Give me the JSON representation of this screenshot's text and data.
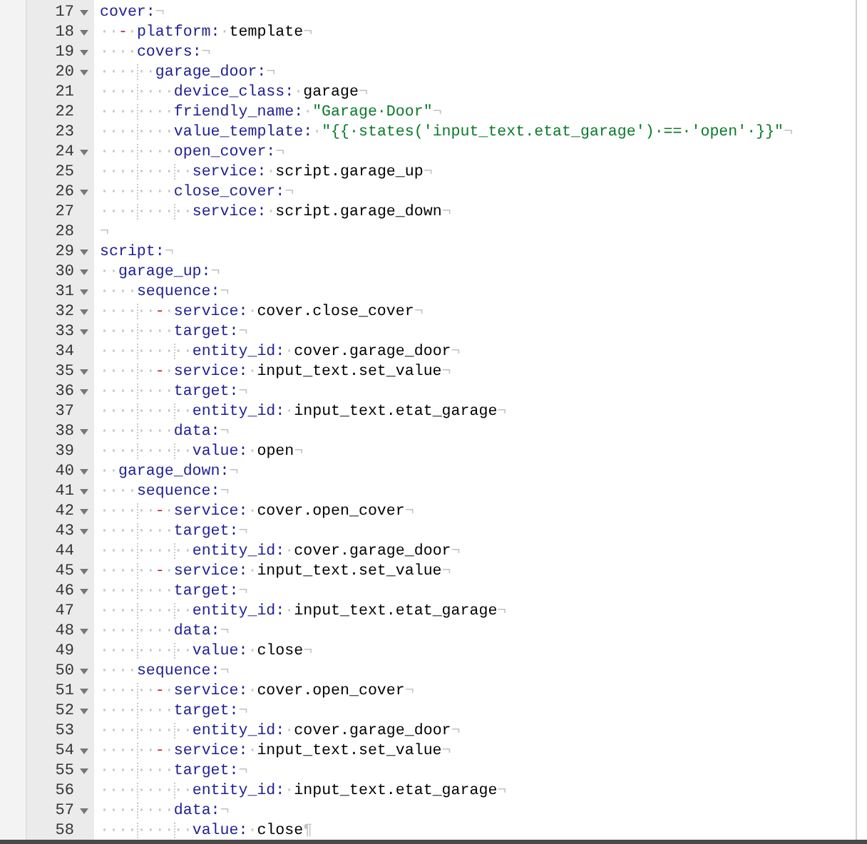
{
  "lines": [
    {
      "number": "17",
      "foldable": true,
      "parts": [
        {
          "kind": "key",
          "text": "cover:"
        }
      ],
      "eol": "¬"
    },
    {
      "number": "18",
      "foldable": true,
      "indent": "··",
      "parts": [
        {
          "kind": "dash",
          "text": "-"
        },
        {
          "kind": "ws",
          "text": "·"
        },
        {
          "kind": "key",
          "text": "platform:"
        },
        {
          "kind": "ws",
          "text": "·"
        },
        {
          "kind": "val",
          "text": "template"
        }
      ],
      "eol": "¬"
    },
    {
      "number": "19",
      "foldable": true,
      "indent": "····",
      "parts": [
        {
          "kind": "key",
          "text": "covers:"
        }
      ],
      "eol": "¬"
    },
    {
      "number": "20",
      "foldable": true,
      "indent": "······",
      "parts": [
        {
          "kind": "key",
          "text": "garage_door:"
        }
      ],
      "eol": "¬"
    },
    {
      "number": "21",
      "foldable": false,
      "indent": "········",
      "parts": [
        {
          "kind": "key",
          "text": "device_class:"
        },
        {
          "kind": "ws",
          "text": "·"
        },
        {
          "kind": "val",
          "text": "garage"
        }
      ],
      "eol": "¬"
    },
    {
      "number": "22",
      "foldable": false,
      "indent": "········",
      "parts": [
        {
          "kind": "key",
          "text": "friendly_name:"
        },
        {
          "kind": "ws",
          "text": "·"
        },
        {
          "kind": "str",
          "text": "\"Garage·Door\""
        }
      ],
      "eol": "¬"
    },
    {
      "number": "23",
      "foldable": false,
      "indent": "········",
      "parts": [
        {
          "kind": "key",
          "text": "value_template:"
        },
        {
          "kind": "ws",
          "text": "·"
        },
        {
          "kind": "str",
          "text": "\"{{·states('input_text.etat_garage')·==·'open'·}}\""
        }
      ],
      "eol": "¬"
    },
    {
      "number": "24",
      "foldable": true,
      "indent": "········",
      "parts": [
        {
          "kind": "key",
          "text": "open_cover:"
        }
      ],
      "eol": "¬"
    },
    {
      "number": "25",
      "foldable": false,
      "indent": "··········",
      "parts": [
        {
          "kind": "key",
          "text": "service:"
        },
        {
          "kind": "ws",
          "text": "·"
        },
        {
          "kind": "val",
          "text": "script.garage_up"
        }
      ],
      "eol": "¬"
    },
    {
      "number": "26",
      "foldable": true,
      "indent": "········",
      "parts": [
        {
          "kind": "key",
          "text": "close_cover:"
        }
      ],
      "eol": "¬"
    },
    {
      "number": "27",
      "foldable": false,
      "indent": "··········",
      "parts": [
        {
          "kind": "key",
          "text": "service:"
        },
        {
          "kind": "ws",
          "text": "·"
        },
        {
          "kind": "val",
          "text": "script.garage_down"
        }
      ],
      "eol": "¬"
    },
    {
      "number": "28",
      "foldable": false,
      "eol": "¬"
    },
    {
      "number": "29",
      "foldable": true,
      "parts": [
        {
          "kind": "key",
          "text": "script:"
        }
      ],
      "eol": "¬"
    },
    {
      "number": "30",
      "foldable": true,
      "indent": "··",
      "parts": [
        {
          "kind": "key",
          "text": "garage_up:"
        }
      ],
      "eol": "¬"
    },
    {
      "number": "31",
      "foldable": true,
      "indent": "····",
      "parts": [
        {
          "kind": "key",
          "text": "sequence:"
        }
      ],
      "eol": "¬"
    },
    {
      "number": "32",
      "foldable": true,
      "indent": "······",
      "parts": [
        {
          "kind": "dash",
          "text": "-"
        },
        {
          "kind": "ws",
          "text": "·"
        },
        {
          "kind": "key",
          "text": "service:"
        },
        {
          "kind": "ws",
          "text": "·"
        },
        {
          "kind": "val",
          "text": "cover.close_cover"
        }
      ],
      "eol": "¬"
    },
    {
      "number": "33",
      "foldable": true,
      "indent": "········",
      "parts": [
        {
          "kind": "key",
          "text": "target:"
        }
      ],
      "eol": "¬"
    },
    {
      "number": "34",
      "foldable": false,
      "indent": "··········",
      "parts": [
        {
          "kind": "key",
          "text": "entity_id:"
        },
        {
          "kind": "ws",
          "text": "·"
        },
        {
          "kind": "val",
          "text": "cover.garage_door"
        }
      ],
      "eol": "¬"
    },
    {
      "number": "35",
      "foldable": true,
      "indent": "······",
      "parts": [
        {
          "kind": "dash",
          "text": "-"
        },
        {
          "kind": "ws",
          "text": "·"
        },
        {
          "kind": "key",
          "text": "service:"
        },
        {
          "kind": "ws",
          "text": "·"
        },
        {
          "kind": "val",
          "text": "input_text.set_value"
        }
      ],
      "eol": "¬"
    },
    {
      "number": "36",
      "foldable": true,
      "indent": "········",
      "parts": [
        {
          "kind": "key",
          "text": "target:"
        }
      ],
      "eol": "¬"
    },
    {
      "number": "37",
      "foldable": false,
      "indent": "··········",
      "parts": [
        {
          "kind": "key",
          "text": "entity_id:"
        },
        {
          "kind": "ws",
          "text": "·"
        },
        {
          "kind": "val",
          "text": "input_text.etat_garage"
        }
      ],
      "eol": "¬"
    },
    {
      "number": "38",
      "foldable": true,
      "indent": "········",
      "parts": [
        {
          "kind": "key",
          "text": "data:"
        }
      ],
      "eol": "¬"
    },
    {
      "number": "39",
      "foldable": false,
      "indent": "··········",
      "parts": [
        {
          "kind": "key",
          "text": "value:"
        },
        {
          "kind": "ws",
          "text": "·"
        },
        {
          "kind": "val",
          "text": "open"
        }
      ],
      "eol": "¬"
    },
    {
      "number": "40",
      "foldable": true,
      "indent": "··",
      "parts": [
        {
          "kind": "key",
          "text": "garage_down:"
        }
      ],
      "eol": "¬"
    },
    {
      "number": "41",
      "foldable": true,
      "indent": "····",
      "parts": [
        {
          "kind": "key",
          "text": "sequence:"
        }
      ],
      "eol": "¬"
    },
    {
      "number": "42",
      "foldable": true,
      "indent": "······",
      "parts": [
        {
          "kind": "dash",
          "text": "-"
        },
        {
          "kind": "ws",
          "text": "·"
        },
        {
          "kind": "key",
          "text": "service:"
        },
        {
          "kind": "ws",
          "text": "·"
        },
        {
          "kind": "val",
          "text": "cover.open_cover"
        }
      ],
      "eol": "¬"
    },
    {
      "number": "43",
      "foldable": true,
      "indent": "········",
      "parts": [
        {
          "kind": "key",
          "text": "target:"
        }
      ],
      "eol": "¬"
    },
    {
      "number": "44",
      "foldable": false,
      "indent": "··········",
      "parts": [
        {
          "kind": "key",
          "text": "entity_id:"
        },
        {
          "kind": "ws",
          "text": "·"
        },
        {
          "kind": "val",
          "text": "cover.garage_door"
        }
      ],
      "eol": "¬"
    },
    {
      "number": "45",
      "foldable": true,
      "indent": "······",
      "parts": [
        {
          "kind": "dash",
          "text": "-"
        },
        {
          "kind": "ws",
          "text": "·"
        },
        {
          "kind": "key",
          "text": "service:"
        },
        {
          "kind": "ws",
          "text": "·"
        },
        {
          "kind": "val",
          "text": "input_text.set_value"
        }
      ],
      "eol": "¬"
    },
    {
      "number": "46",
      "foldable": true,
      "indent": "········",
      "parts": [
        {
          "kind": "key",
          "text": "target:"
        }
      ],
      "eol": "¬"
    },
    {
      "number": "47",
      "foldable": false,
      "indent": "··········",
      "parts": [
        {
          "kind": "key",
          "text": "entity_id:"
        },
        {
          "kind": "ws",
          "text": "·"
        },
        {
          "kind": "val",
          "text": "input_text.etat_garage"
        }
      ],
      "eol": "¬"
    },
    {
      "number": "48",
      "foldable": true,
      "indent": "········",
      "parts": [
        {
          "kind": "key",
          "text": "data:"
        }
      ],
      "eol": "¬"
    },
    {
      "number": "49",
      "foldable": false,
      "indent": "··········",
      "parts": [
        {
          "kind": "key",
          "text": "value:"
        },
        {
          "kind": "ws",
          "text": "·"
        },
        {
          "kind": "val",
          "text": "close"
        }
      ],
      "eol": "¬"
    },
    {
      "number": "50",
      "foldable": true,
      "indent": "····",
      "parts": [
        {
          "kind": "key",
          "text": "sequence:"
        }
      ],
      "eol": "¬"
    },
    {
      "number": "51",
      "foldable": true,
      "indent": "······",
      "parts": [
        {
          "kind": "dash",
          "text": "-"
        },
        {
          "kind": "ws",
          "text": "·"
        },
        {
          "kind": "key",
          "text": "service:"
        },
        {
          "kind": "ws",
          "text": "·"
        },
        {
          "kind": "val",
          "text": "cover.open_cover"
        }
      ],
      "eol": "¬"
    },
    {
      "number": "52",
      "foldable": true,
      "indent": "········",
      "parts": [
        {
          "kind": "key",
          "text": "target:"
        }
      ],
      "eol": "¬"
    },
    {
      "number": "53",
      "foldable": false,
      "indent": "··········",
      "parts": [
        {
          "kind": "key",
          "text": "entity_id:"
        },
        {
          "kind": "ws",
          "text": "·"
        },
        {
          "kind": "val",
          "text": "cover.garage_door"
        }
      ],
      "eol": "¬"
    },
    {
      "number": "54",
      "foldable": true,
      "indent": "······",
      "parts": [
        {
          "kind": "dash",
          "text": "-"
        },
        {
          "kind": "ws",
          "text": "·"
        },
        {
          "kind": "key",
          "text": "service:"
        },
        {
          "kind": "ws",
          "text": "·"
        },
        {
          "kind": "val",
          "text": "input_text.set_value"
        }
      ],
      "eol": "¬"
    },
    {
      "number": "55",
      "foldable": true,
      "indent": "········",
      "parts": [
        {
          "kind": "key",
          "text": "target:"
        }
      ],
      "eol": "¬"
    },
    {
      "number": "56",
      "foldable": false,
      "indent": "··········",
      "parts": [
        {
          "kind": "key",
          "text": "entity_id:"
        },
        {
          "kind": "ws",
          "text": "·"
        },
        {
          "kind": "val",
          "text": "input_text.etat_garage"
        }
      ],
      "eol": "¬"
    },
    {
      "number": "57",
      "foldable": true,
      "indent": "········",
      "parts": [
        {
          "kind": "key",
          "text": "data:"
        }
      ],
      "eol": "¬"
    },
    {
      "number": "58",
      "foldable": false,
      "indent": "··········",
      "parts": [
        {
          "kind": "key",
          "text": "value:"
        },
        {
          "kind": "ws",
          "text": "·"
        },
        {
          "kind": "val",
          "text": "close"
        }
      ],
      "eol": "¶"
    }
  ]
}
